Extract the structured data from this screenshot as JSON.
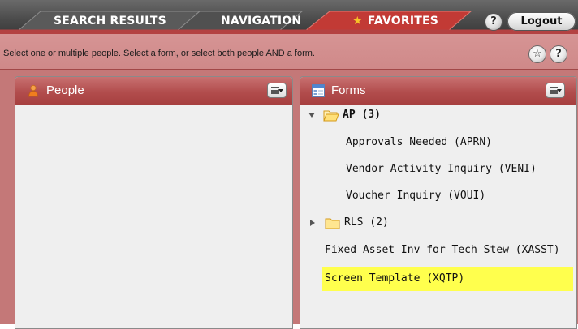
{
  "tabs": {
    "search_results": "SEARCH RESULTS",
    "navigation": "NAVIGATION",
    "favorites": "FAVORITES",
    "help": "?",
    "logout": "Logout"
  },
  "instructions": {
    "text": "Select one or multiple people.  Select a form, or select both people AND a form.",
    "favorite_icon": "star-icon",
    "help": "?"
  },
  "people_panel": {
    "title": "People",
    "icon": "person-icon",
    "menu_icon": "list-menu-icon"
  },
  "forms_panel": {
    "title": "Forms",
    "icon": "form-icon",
    "menu_icon": "list-menu-icon",
    "tree": {
      "folder_ap": "AP (3)",
      "ap_items": [
        "Approvals Needed (APRN)",
        "Vendor Activity Inquiry (VENI)",
        "Voucher Inquiry (VOUI)"
      ],
      "folder_rls": "RLS (2)",
      "root_items": [
        "Fixed Asset Inv for Tech Stew (XASST)",
        "Screen Template (XQTP)"
      ],
      "selected_item": "Screen Template (XQTP)"
    }
  },
  "colors": {
    "active_tab": "#c0392b",
    "header_bar": "#cf8989",
    "panel_header": "#b24d4d",
    "highlight": "#ffff4d",
    "star": "#f7c328"
  }
}
